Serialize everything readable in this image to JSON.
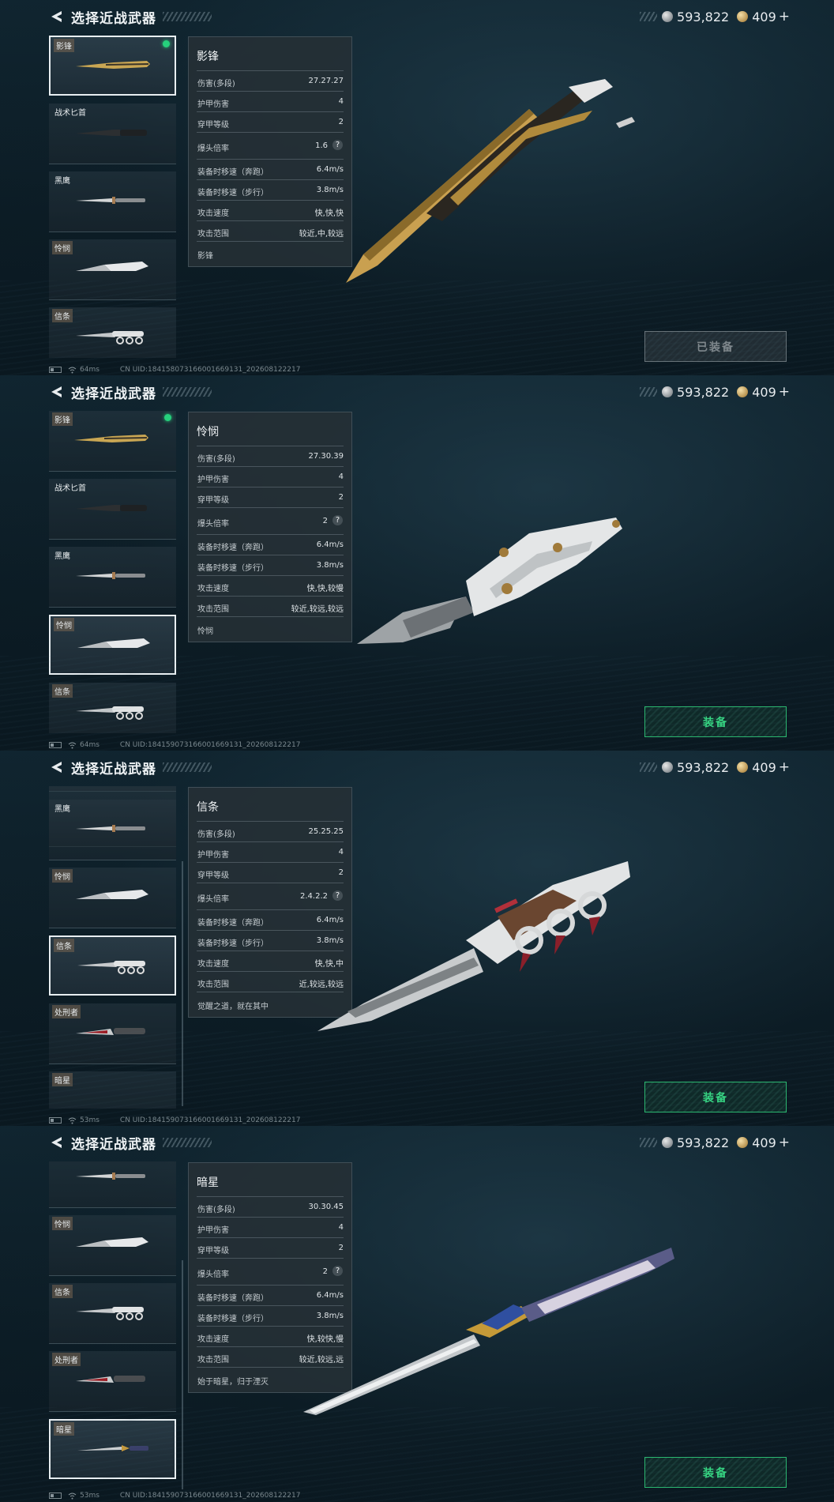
{
  "screens": [
    {
      "title": "选择近战武器",
      "currency": {
        "silver": "593,822",
        "gold": "409",
        "plus": "+"
      },
      "cards": [
        {
          "label": "影锋",
          "tag": true,
          "equipped": true,
          "selected": true
        },
        {
          "label": "战术匕首",
          "tag": false
        },
        {
          "label": "黑鹰",
          "tag": false
        },
        {
          "label": "怜悯",
          "tag": true
        },
        {
          "label": "信条",
          "tag": true
        }
      ],
      "panel": {
        "name": "影锋",
        "stats": [
          {
            "k": "伤害(多段)",
            "v": "27.27.27"
          },
          {
            "k": "护甲伤害",
            "v": "4"
          },
          {
            "k": "穿甲等级",
            "v": "2"
          },
          {
            "k": "爆头倍率",
            "v": "1.6"
          },
          {
            "k": "装备时移速（奔跑）",
            "v": "6.4m/s"
          },
          {
            "k": "装备时移速（步行）",
            "v": "3.8m/s"
          },
          {
            "k": "攻击速度",
            "v": "快,快,快"
          },
          {
            "k": "攻击范围",
            "v": "较近,中,较远"
          }
        ],
        "desc": "影锋",
        "help": "?"
      },
      "button": "已装备",
      "ping": "64ms",
      "uid": "CN UID:18415807316600166913​1_202608122217"
    },
    {
      "title": "选择近战武器",
      "currency": {
        "silver": "593,822",
        "gold": "409",
        "plus": "+"
      },
      "cards": [
        {
          "label": "影锋",
          "tag": true,
          "equipped": true
        },
        {
          "label": "战术匕首",
          "tag": false
        },
        {
          "label": "黑鹰",
          "tag": false
        },
        {
          "label": "怜悯",
          "tag": true,
          "selected": true
        },
        {
          "label": "信条",
          "tag": true
        }
      ],
      "panel": {
        "name": "怜悯",
        "stats": [
          {
            "k": "伤害(多段)",
            "v": "27.30.39"
          },
          {
            "k": "护甲伤害",
            "v": "4"
          },
          {
            "k": "穿甲等级",
            "v": "2"
          },
          {
            "k": "爆头倍率",
            "v": "2"
          },
          {
            "k": "装备时移速（奔跑）",
            "v": "6.4m/s"
          },
          {
            "k": "装备时移速（步行）",
            "v": "3.8m/s"
          },
          {
            "k": "攻击速度",
            "v": "快,快,较慢"
          },
          {
            "k": "攻击范围",
            "v": "较近,较远,较远"
          }
        ],
        "desc": "怜悯",
        "help": "?"
      },
      "button": "装备",
      "ping": "64ms",
      "uid": "CN UID:184159073166001669131_202608122217"
    },
    {
      "title": "选择近战武器",
      "currency": {
        "silver": "593,822",
        "gold": "409",
        "plus": "+"
      },
      "cards": [
        {
          "label": "黑鹰",
          "tag": false
        },
        {
          "label": "怜悯",
          "tag": true
        },
        {
          "label": "信条",
          "tag": true,
          "selected": true
        },
        {
          "label": "处刑者",
          "tag": true
        },
        {
          "label": "暗星",
          "tag": true
        }
      ],
      "panel": {
        "name": "信条",
        "stats": [
          {
            "k": "伤害(多段)",
            "v": "25.25.25"
          },
          {
            "k": "护甲伤害",
            "v": "4"
          },
          {
            "k": "穿甲等级",
            "v": "2"
          },
          {
            "k": "爆头倍率",
            "v": "2.4.2.2"
          },
          {
            "k": "装备时移速（奔跑）",
            "v": "6.4m/s"
          },
          {
            "k": "装备时移速（步行）",
            "v": "3.8m/s"
          },
          {
            "k": "攻击速度",
            "v": "快,快,中"
          },
          {
            "k": "攻击范围",
            "v": "近,较远,较远"
          }
        ],
        "desc": "觉醒之道，就在其中",
        "help": "?"
      },
      "button": "装备",
      "ping": "53ms",
      "uid": "CN UID:184159073166001669131_202608122217"
    },
    {
      "title": "选择近战武器",
      "currency": {
        "silver": "593,822",
        "gold": "409",
        "plus": "+"
      },
      "cards": [
        {
          "label": "",
          "tag": false
        },
        {
          "label": "怜悯",
          "tag": true
        },
        {
          "label": "信条",
          "tag": true
        },
        {
          "label": "处刑者",
          "tag": true
        },
        {
          "label": "暗星",
          "tag": true,
          "selected": true
        }
      ],
      "panel": {
        "name": "暗星",
        "stats": [
          {
            "k": "伤害(多段)",
            "v": "30.30.45"
          },
          {
            "k": "护甲伤害",
            "v": "4"
          },
          {
            "k": "穿甲等级",
            "v": "2"
          },
          {
            "k": "爆头倍率",
            "v": "2"
          },
          {
            "k": "装备时移速（奔跑）",
            "v": "6.4m/s"
          },
          {
            "k": "装备时移速（步行）",
            "v": "3.8m/s"
          },
          {
            "k": "攻击速度",
            "v": "快,较快,慢"
          },
          {
            "k": "攻击范围",
            "v": "较近,较远,远"
          }
        ],
        "desc": "始于暗星，归于湮灭",
        "help": "?"
      },
      "button": "装备",
      "ping": "53ms",
      "uid": "CN UID:184159073166001669131_202608122217"
    }
  ]
}
